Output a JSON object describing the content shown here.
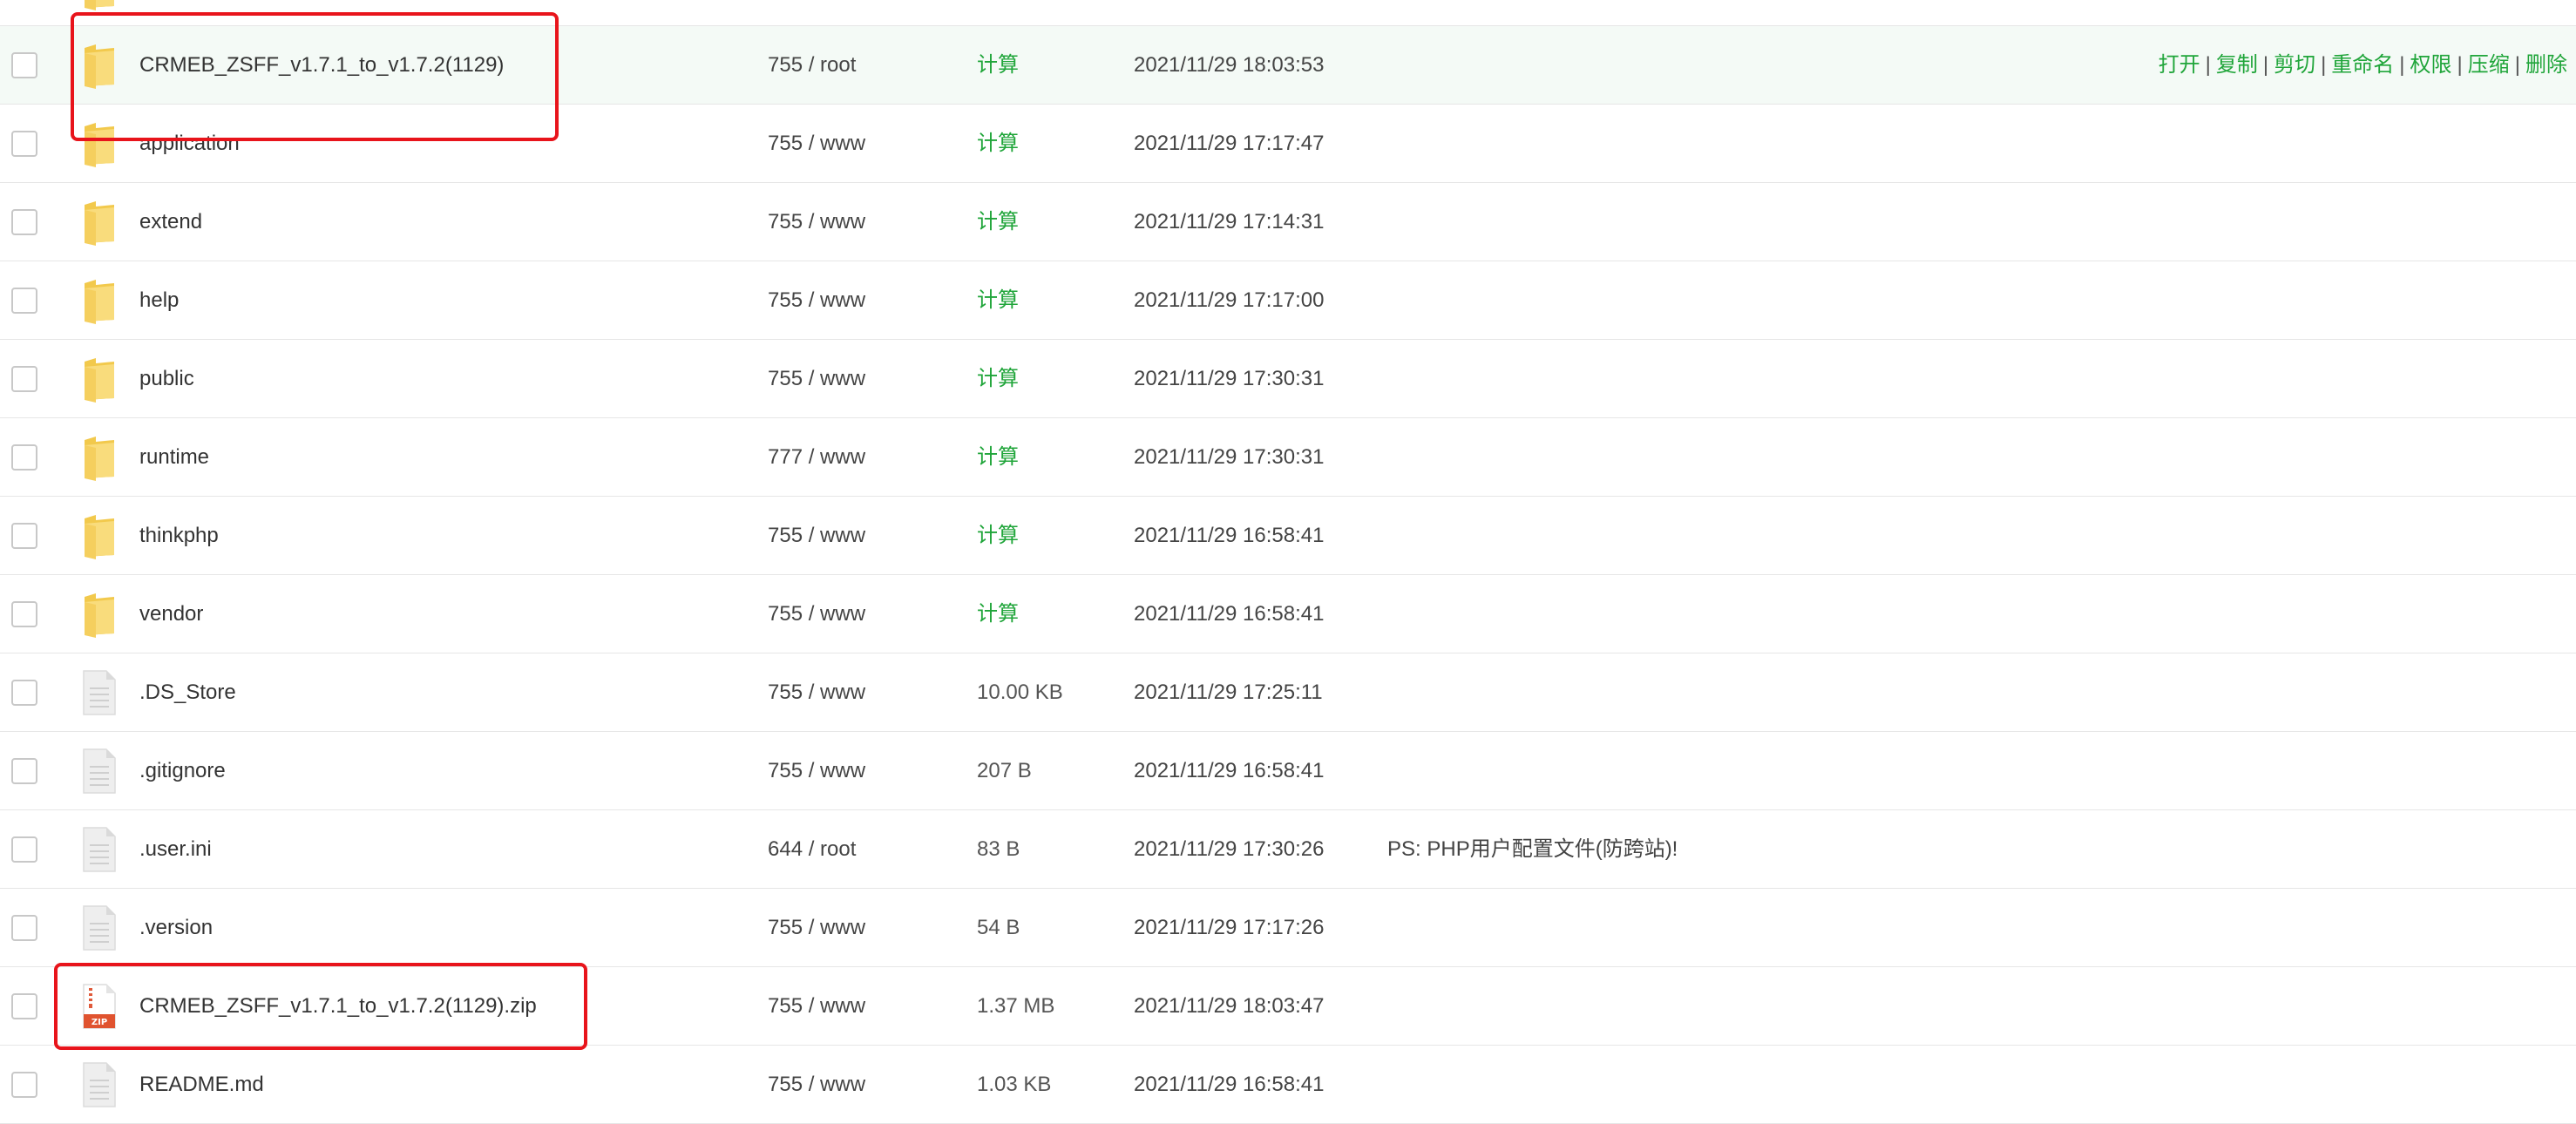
{
  "row_actions": [
    "打开",
    "复制",
    "剪切",
    "重命名",
    "权限",
    "压缩",
    "删除"
  ],
  "files": [
    {
      "name": "",
      "type": "folder",
      "permission": "",
      "size": "",
      "modified": "",
      "note": ""
    },
    {
      "name": "CRMEB_ZSFF_v1.7.1_to_v1.7.2(1129)",
      "type": "folder",
      "permission": "755 / root",
      "size": "计算",
      "modified": "2021/11/29 18:03:53",
      "note": ""
    },
    {
      "name": "application",
      "type": "folder",
      "permission": "755 / www",
      "size": "计算",
      "modified": "2021/11/29 17:17:47",
      "note": ""
    },
    {
      "name": "extend",
      "type": "folder",
      "permission": "755 / www",
      "size": "计算",
      "modified": "2021/11/29 17:14:31",
      "note": ""
    },
    {
      "name": "help",
      "type": "folder",
      "permission": "755 / www",
      "size": "计算",
      "modified": "2021/11/29 17:17:00",
      "note": ""
    },
    {
      "name": "public",
      "type": "folder",
      "permission": "755 / www",
      "size": "计算",
      "modified": "2021/11/29 17:30:31",
      "note": ""
    },
    {
      "name": "runtime",
      "type": "folder",
      "permission": "777 / www",
      "size": "计算",
      "modified": "2021/11/29 17:30:31",
      "note": ""
    },
    {
      "name": "thinkphp",
      "type": "folder",
      "permission": "755 / www",
      "size": "计算",
      "modified": "2021/11/29 16:58:41",
      "note": ""
    },
    {
      "name": "vendor",
      "type": "folder",
      "permission": "755 / www",
      "size": "计算",
      "modified": "2021/11/29 16:58:41",
      "note": ""
    },
    {
      "name": ".DS_Store",
      "type": "file",
      "permission": "755 / www",
      "size": "10.00 KB",
      "modified": "2021/11/29 17:25:11",
      "note": ""
    },
    {
      "name": ".gitignore",
      "type": "file",
      "permission": "755 / www",
      "size": "207 B",
      "modified": "2021/11/29 16:58:41",
      "note": ""
    },
    {
      "name": ".user.ini",
      "type": "file",
      "permission": "644 / root",
      "size": "83 B",
      "modified": "2021/11/29 17:30:26",
      "note": "PS: PHP用户配置文件(防跨站)!"
    },
    {
      "name": ".version",
      "type": "file",
      "permission": "755 / www",
      "size": "54 B",
      "modified": "2021/11/29 17:17:26",
      "note": ""
    },
    {
      "name": "CRMEB_ZSFF_v1.7.1_to_v1.7.2(1129).zip",
      "type": "zip",
      "permission": "755 / www",
      "size": "1.37 MB",
      "modified": "2021/11/29 18:03:47",
      "note": ""
    },
    {
      "name": "README.md",
      "type": "file",
      "permission": "755 / www",
      "size": "1.03 KB",
      "modified": "2021/11/29 16:58:41",
      "note": ""
    }
  ],
  "icons": {
    "folder": "folder-icon",
    "file": "file-icon",
    "zip": "zip-icon",
    "checkbox": "checkbox"
  },
  "colors": {
    "accent": "#20a53a",
    "highlight_row": "#f4faf6",
    "annotation": "#e8141b",
    "folder": "#f7d774"
  }
}
